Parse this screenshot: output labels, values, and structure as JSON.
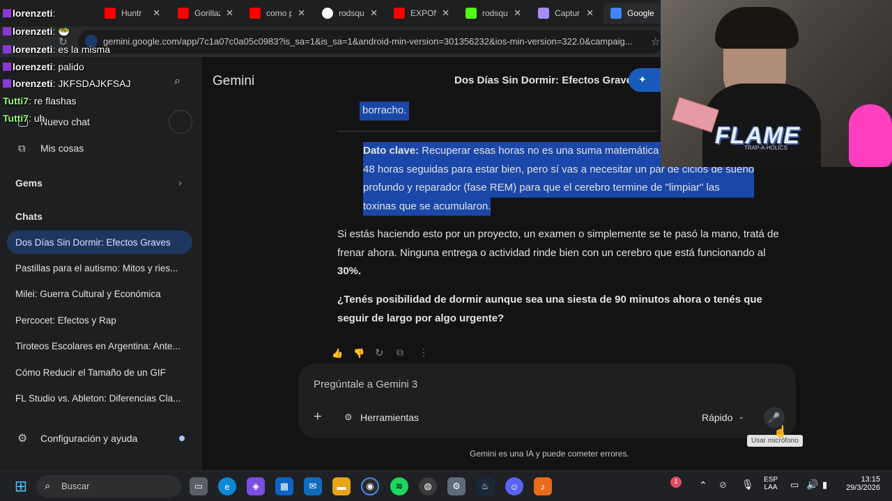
{
  "browser": {
    "tabs": [
      {
        "title": "Huntr",
        "color": "#ff0000"
      },
      {
        "title": "Gorillaz",
        "color": "#ff0000"
      },
      {
        "title": "como p",
        "color": "#ff0000"
      },
      {
        "title": "rodsqu",
        "color": "#ffffff"
      },
      {
        "title": "EXPON",
        "color": "#ff0000"
      },
      {
        "title": "rodsqu",
        "color": "#53fc18"
      },
      {
        "title": "Captur",
        "color": "#a48cff"
      },
      {
        "title": "Google",
        "color": "#4285f4"
      }
    ],
    "url": "gemini.google.com/app/7c1a07c0a05c0983?is_sa=1&is_sa=1&android-min-version=301356232&ios-min-version=322.0&campaig..."
  },
  "sidebar": {
    "new_chat": "Nuevo chat",
    "my_stuff": "Mis cosas",
    "gems": "Gems",
    "chats_heading": "Chats",
    "chats": [
      "Dos Días Sin Dormir: Efectos Graves",
      "Pastillas para el autismo: Mitos y ries...",
      "Milei: Guerra Cultural y Económica",
      "Percocet: Efectos y Rap",
      "Tiroteos Escolares en Argentina: Ante...",
      "Cómo Reducir el Tamaño de un GIF",
      "FL Studio vs. Ableton: Diferencias Cla..."
    ],
    "settings": "Configuración y ayuda"
  },
  "main": {
    "brand": "Gemini",
    "conversation_title": "Dos Días Sin Dormir: Efectos Graves",
    "top_word": "borracho.",
    "key_label": "Dato clave:",
    "key_lines": [
      " Recuperar esas horas no es una suma matemática",
      "48 horas seguidas para estar bien, pero sí vas a necesitar un par de ciclos de sueño",
      "profundo y reparador (fase REM) para que el cerebro termine de \"limpiar\" las",
      "toxinas que se acumularon."
    ],
    "para_lines": [
      "Si estás haciendo esto por un proyecto, un examen o simplemente se te pasó la mano, tratá de",
      "frenar ahora. Ninguna entrega o actividad rinde bien con un cerebro que está funcionando al"
    ],
    "para_end": "30%.",
    "question_lines": [
      "¿Tenés posibilidad de dormir aunque sea una siesta de 90 minutos ahora o tenés que",
      "seguir de largo por algo urgente?"
    ],
    "input_placeholder": "Pregúntale a Gemini 3",
    "tools_label": "Herramientas",
    "mode_label": "Rápido",
    "mic_tooltip": "Usar micrófono",
    "disclaimer": "Gemini es una IA y puede cometer errores.",
    "accent": "#1a47a8"
  },
  "chat_overlay": [
    {
      "user": "lorenzeti",
      "msg": "",
      "green": false
    },
    {
      "user": "lorenzeti",
      "msg": " 🥗",
      "green": false
    },
    {
      "user": "lorenzeti",
      "msg": " es la misma",
      "green": false
    },
    {
      "user": "lorenzeti",
      "msg": " palido",
      "green": false
    },
    {
      "user": "lorenzeti",
      "msg": " JKFSDAJKFSAJ",
      "green": false
    },
    {
      "user": "Tutti7",
      "msg": " re flashas",
      "green": true
    },
    {
      "user": "Tutti7",
      "msg": " uh",
      "green": true
    }
  ],
  "webcam": {
    "banner": "FLAME",
    "sub": "TRAP-A-HOLICS"
  },
  "taskbar": {
    "search_label": "Buscar",
    "lang_top": "ESP",
    "lang_bottom": "LAA",
    "time": "13:15",
    "date": "29/3/2026",
    "notif_count": "1"
  }
}
